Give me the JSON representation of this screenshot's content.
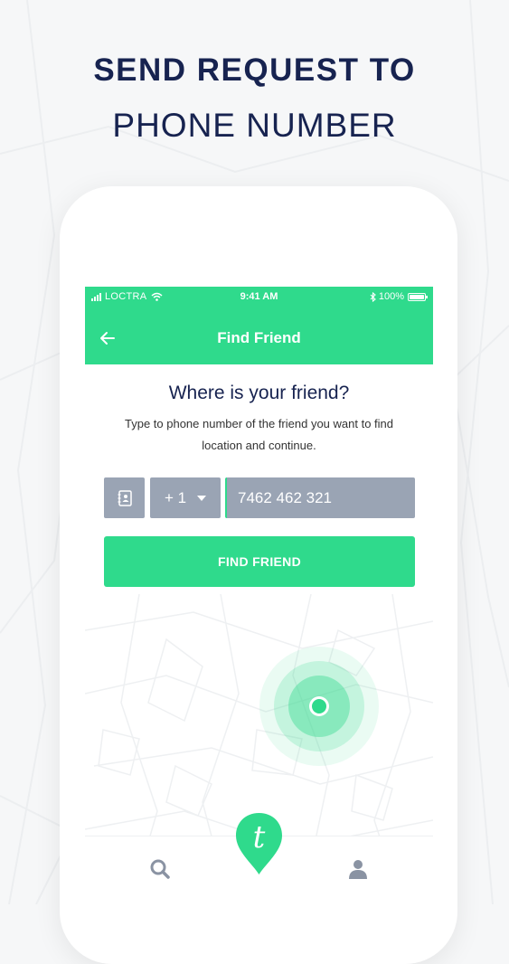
{
  "hero": {
    "title": "SEND REQUEST TO",
    "subtitle": "PHONE NUMBER"
  },
  "status_bar": {
    "carrier": "LOCTRA",
    "time": "9:41 AM",
    "battery": "100%"
  },
  "appbar": {
    "title": "Find Friend"
  },
  "content": {
    "question": "Where is your friend?",
    "description": "Type to phone number of the friend you want to find location and continue."
  },
  "form": {
    "country_code": "+ 1",
    "phone_value": "7462 462 321",
    "submit_label": "FIND FRIEND"
  },
  "nav": {
    "logo_letter": "t"
  },
  "colors": {
    "accent": "#2fda8c",
    "navy": "#172350",
    "field_gray": "#9aa4b4",
    "icon_gray": "#8a93a3"
  }
}
